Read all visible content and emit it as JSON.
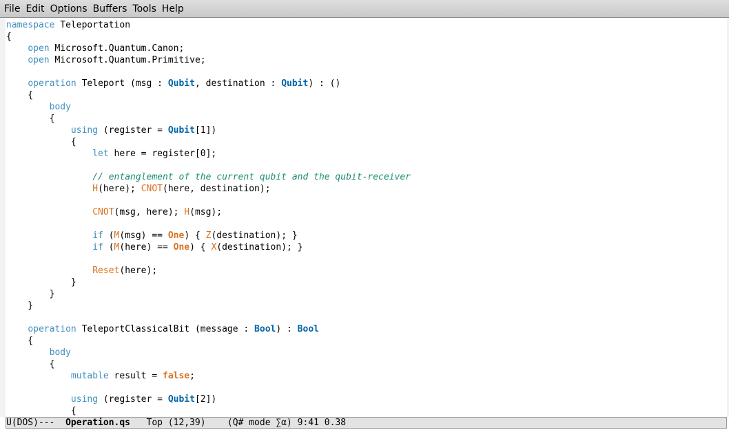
{
  "menubar": {
    "items": [
      "File",
      "Edit",
      "Options",
      "Buffers",
      "Tools",
      "Help"
    ]
  },
  "colors": {
    "keyword": "#3f8fbf",
    "type": "#0065a8",
    "function": "#d9711f",
    "comment": "#1c8c74"
  },
  "code_lines": [
    [
      [
        "kw",
        "namespace"
      ],
      [
        "p",
        " Teleportation"
      ]
    ],
    [
      [
        "p",
        "{"
      ]
    ],
    [
      [
        "p",
        "    "
      ],
      [
        "kw",
        "open"
      ],
      [
        "p",
        " Microsoft.Quantum.Canon;"
      ]
    ],
    [
      [
        "p",
        "    "
      ],
      [
        "kw",
        "open"
      ],
      [
        "p",
        " Microsoft.Quantum.Primitive;"
      ]
    ],
    [],
    [
      [
        "p",
        "    "
      ],
      [
        "kw",
        "operation"
      ],
      [
        "p",
        " Teleport (msg : "
      ],
      [
        "ty",
        "Qubit"
      ],
      [
        "p",
        ", destination : "
      ],
      [
        "ty",
        "Qubit"
      ],
      [
        "p",
        ") : ()"
      ]
    ],
    [
      [
        "p",
        "    {"
      ]
    ],
    [
      [
        "p",
        "        "
      ],
      [
        "kw",
        "body"
      ]
    ],
    [
      [
        "p",
        "        {"
      ]
    ],
    [
      [
        "p",
        "            "
      ],
      [
        "kw",
        "using"
      ],
      [
        "p",
        " (register = "
      ],
      [
        "ty",
        "Qubit"
      ],
      [
        "p",
        "[1])"
      ]
    ],
    [
      [
        "p",
        "            {"
      ]
    ],
    [
      [
        "p",
        "                "
      ],
      [
        "kw",
        "let"
      ],
      [
        "p",
        " here = register[0];"
      ]
    ],
    [],
    [
      [
        "p",
        "                "
      ],
      [
        "cm",
        "// entanglement of the current qubit and the qubit-receiver"
      ]
    ],
    [
      [
        "p",
        "                "
      ],
      [
        "fn",
        "H"
      ],
      [
        "p",
        "(here); "
      ],
      [
        "fn",
        "CNOT"
      ],
      [
        "p",
        "(here, destination);"
      ]
    ],
    [],
    [
      [
        "p",
        "                "
      ],
      [
        "fn",
        "CNOT"
      ],
      [
        "p",
        "(msg, here); "
      ],
      [
        "fn",
        "H"
      ],
      [
        "p",
        "(msg);"
      ]
    ],
    [],
    [
      [
        "p",
        "                "
      ],
      [
        "kw",
        "if"
      ],
      [
        "p",
        " ("
      ],
      [
        "fn",
        "M"
      ],
      [
        "p",
        "(msg) == "
      ],
      [
        "cst",
        "One"
      ],
      [
        "p",
        ") { "
      ],
      [
        "fn",
        "Z"
      ],
      [
        "p",
        "(destination); }"
      ]
    ],
    [
      [
        "p",
        "                "
      ],
      [
        "kw",
        "if"
      ],
      [
        "p",
        " ("
      ],
      [
        "fn",
        "M"
      ],
      [
        "p",
        "(here) == "
      ],
      [
        "cst",
        "One"
      ],
      [
        "p",
        ") { "
      ],
      [
        "fn",
        "X"
      ],
      [
        "p",
        "(destination); }"
      ]
    ],
    [],
    [
      [
        "p",
        "                "
      ],
      [
        "fn",
        "Reset"
      ],
      [
        "p",
        "(here);"
      ]
    ],
    [
      [
        "p",
        "            }"
      ]
    ],
    [
      [
        "p",
        "        }"
      ]
    ],
    [
      [
        "p",
        "    }"
      ]
    ],
    [],
    [
      [
        "p",
        "    "
      ],
      [
        "kw",
        "operation"
      ],
      [
        "p",
        " TeleportClassicalBit (message : "
      ],
      [
        "ty",
        "Bool"
      ],
      [
        "p",
        ") : "
      ],
      [
        "ty",
        "Bool"
      ]
    ],
    [
      [
        "p",
        "    {"
      ]
    ],
    [
      [
        "p",
        "        "
      ],
      [
        "kw",
        "body"
      ]
    ],
    [
      [
        "p",
        "        {"
      ]
    ],
    [
      [
        "p",
        "            "
      ],
      [
        "kw",
        "mutable"
      ],
      [
        "p",
        " result = "
      ],
      [
        "cst",
        "false"
      ],
      [
        "p",
        ";"
      ]
    ],
    [],
    [
      [
        "p",
        "            "
      ],
      [
        "kw",
        "using"
      ],
      [
        "p",
        " (register = "
      ],
      [
        "ty",
        "Qubit"
      ],
      [
        "p",
        "[2])"
      ]
    ],
    [
      [
        "p",
        "            {"
      ]
    ]
  ],
  "modeline": {
    "prefix": "U(DOS)---  ",
    "buffer_name": "Operation.qs",
    "position": "   Top (12,39)    ",
    "mode": "(Q# mode ∑α)",
    "time_load": " 9:41 0.38"
  }
}
